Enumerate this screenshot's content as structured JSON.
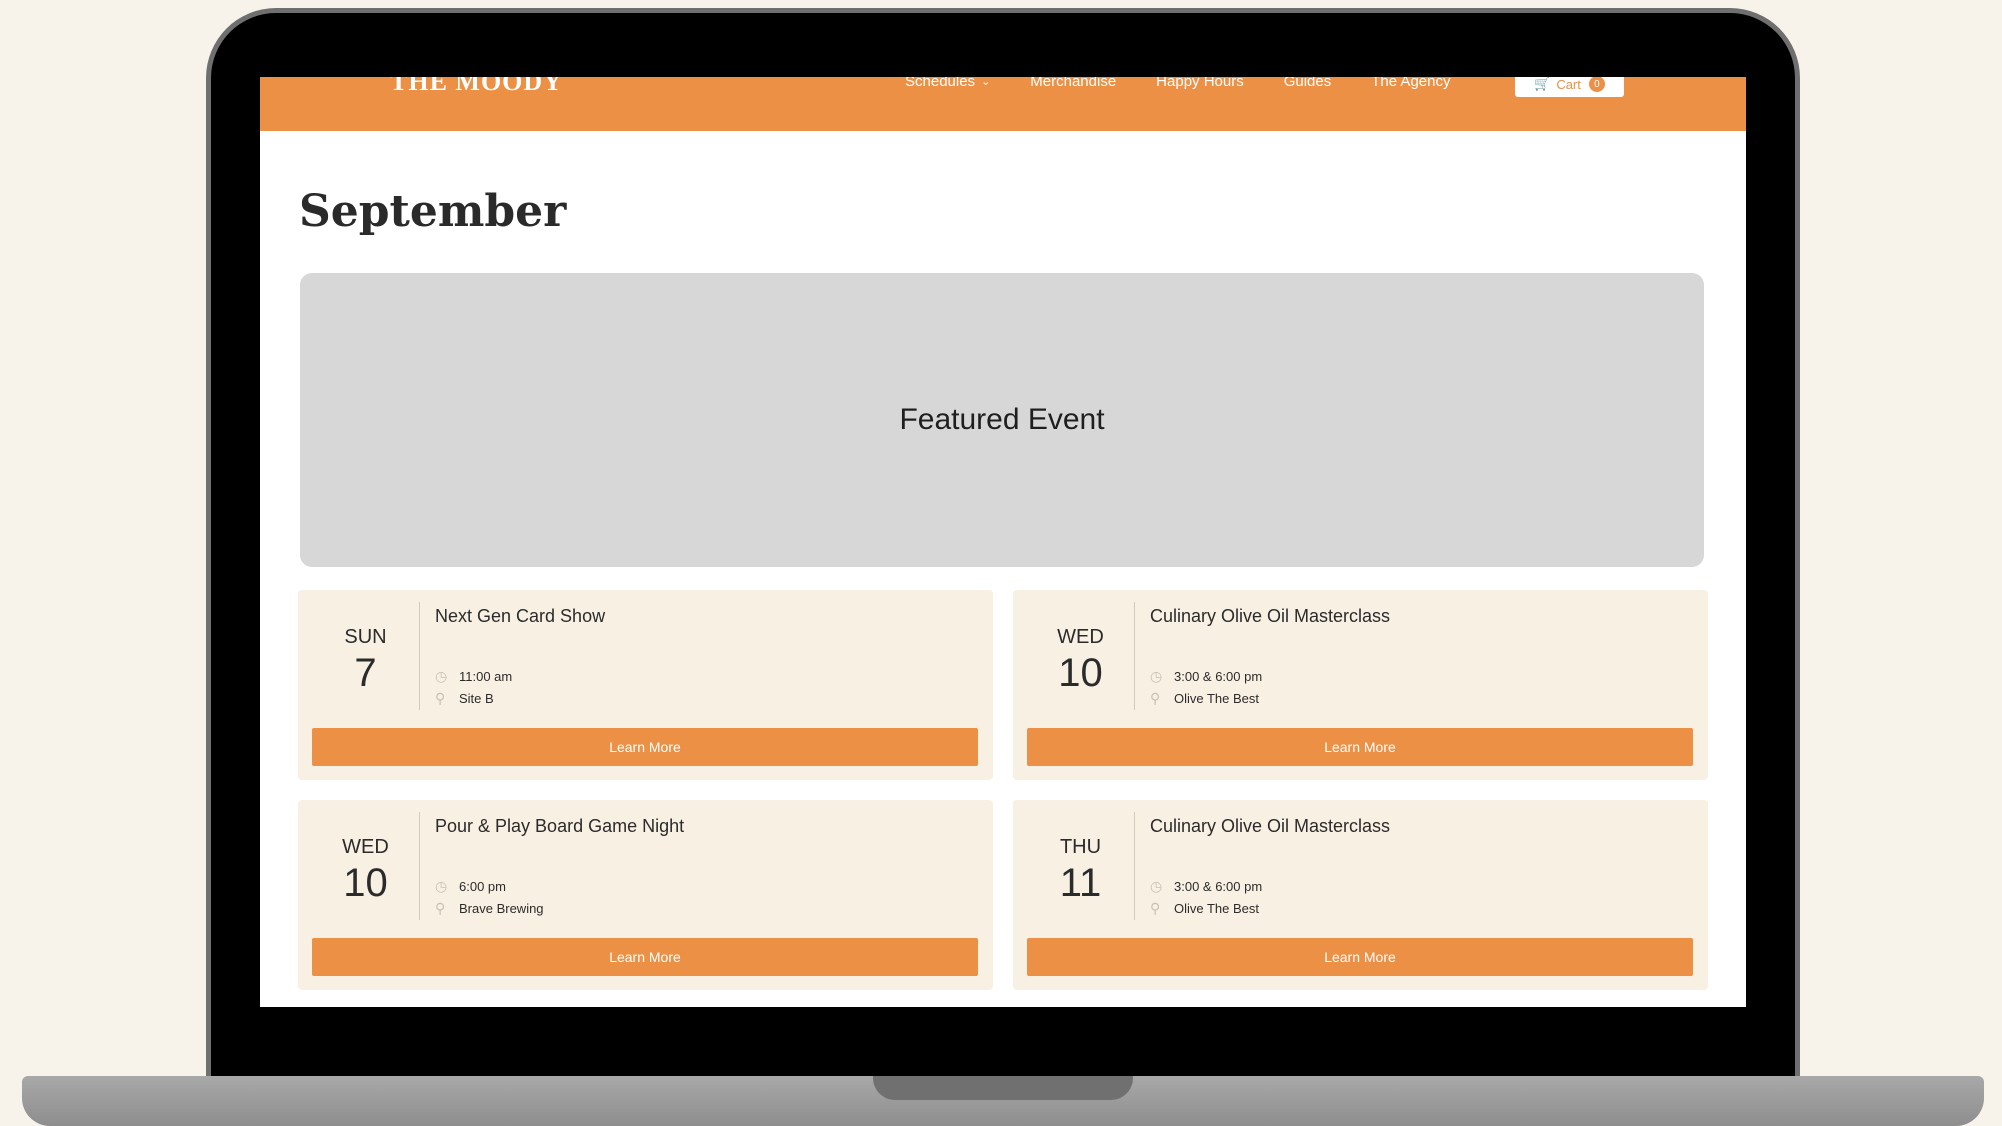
{
  "site": {
    "logo": "THE MOODY"
  },
  "nav": {
    "items": [
      {
        "label": "Schedules"
      },
      {
        "label": "Merchandise"
      },
      {
        "label": "Happy Hours"
      },
      {
        "label": "Guides"
      },
      {
        "label": "The Agency"
      }
    ],
    "cart_label": "Cart",
    "cart_count": "0"
  },
  "page": {
    "title": "September",
    "featured_label": "Featured Event"
  },
  "events": [
    {
      "dow": "SUN",
      "day": "7",
      "title": "Next Gen Card Show",
      "time": "11:00 am",
      "location": "Site B",
      "button": "Learn More"
    },
    {
      "dow": "WED",
      "day": "10",
      "title": "Culinary Olive Oil Masterclass",
      "time": "3:00 & 6:00 pm",
      "location": "Olive The Best",
      "button": "Learn More"
    },
    {
      "dow": "WED",
      "day": "10",
      "title": "Pour & Play Board Game Night",
      "time": "6:00 pm",
      "location": "Brave Brewing",
      "button": "Learn More"
    },
    {
      "dow": "THU",
      "day": "11",
      "title": "Culinary Olive Oil Masterclass",
      "time": "3:00 & 6:00 pm",
      "location": "Olive The Best",
      "button": "Learn More"
    }
  ],
  "icons": {
    "clock": "clock-icon",
    "location": "location-pin-icon",
    "cart": "cart-icon",
    "chevron": "chevron-down-icon"
  },
  "colors": {
    "accent": "#ec9045",
    "card_bg": "#f9f0e4",
    "featured_bg": "#d7d7d7",
    "backdrop": "#f8f3ea"
  }
}
